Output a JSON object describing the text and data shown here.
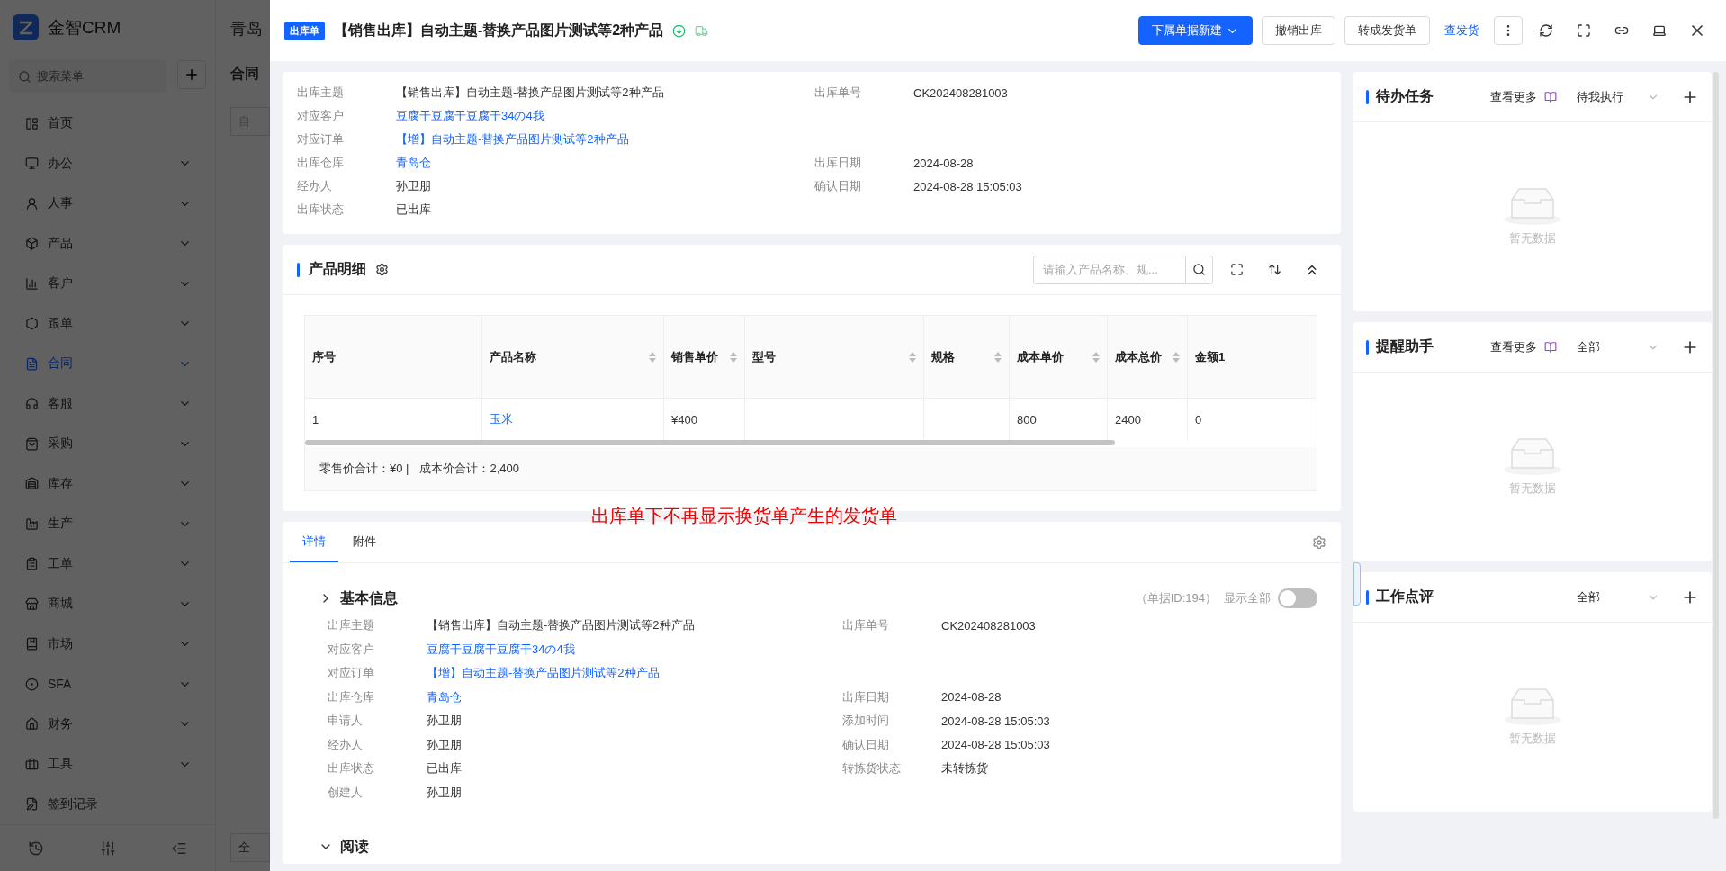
{
  "app": {
    "logo_text": "金智CRM",
    "search_placeholder": "搜索菜单",
    "bg_title": "青岛",
    "bg_heading": "合同",
    "bg_filter": "自",
    "bg_footer": "全",
    "menu": [
      {
        "label": "首页",
        "expandable": false,
        "selected": false
      },
      {
        "label": "办公",
        "expandable": true,
        "selected": false
      },
      {
        "label": "人事",
        "expandable": true,
        "selected": false
      },
      {
        "label": "产品",
        "expandable": true,
        "selected": false
      },
      {
        "label": "客户",
        "expandable": true,
        "selected": false
      },
      {
        "label": "跟单",
        "expandable": true,
        "selected": false
      },
      {
        "label": "合同",
        "expandable": true,
        "selected": true
      },
      {
        "label": "客服",
        "expandable": true,
        "selected": false
      },
      {
        "label": "采购",
        "expandable": true,
        "selected": false
      },
      {
        "label": "库存",
        "expandable": true,
        "selected": false
      },
      {
        "label": "生产",
        "expandable": true,
        "selected": false
      },
      {
        "label": "工单",
        "expandable": true,
        "selected": false
      },
      {
        "label": "商城",
        "expandable": true,
        "selected": false
      },
      {
        "label": "市场",
        "expandable": true,
        "selected": false
      },
      {
        "label": "SFA",
        "expandable": true,
        "selected": false
      },
      {
        "label": "财务",
        "expandable": true,
        "selected": false
      },
      {
        "label": "工具",
        "expandable": true,
        "selected": false
      },
      {
        "label": "签到记录",
        "expandable": false,
        "selected": false
      }
    ]
  },
  "drawer": {
    "badge": "出库单",
    "title": "【销售出库】自动主题-替换产品图片测试等2种产品",
    "actions": [
      {
        "kind": "primary",
        "label": "下属单据新建"
      },
      {
        "kind": "default",
        "label": "撤销出库"
      },
      {
        "kind": "default",
        "label": "转成发货单"
      },
      {
        "kind": "link",
        "label": "查发货"
      }
    ]
  },
  "summary": [
    {
      "left": {
        "label": "出库主题",
        "value": "【销售出库】自动主题-替换产品图片测试等2种产品",
        "link": false
      },
      "right": {
        "label": "出库单号",
        "value": "CK202408281003",
        "link": false
      }
    },
    {
      "left": {
        "label": "对应客户",
        "value": "豆腐干豆腐干豆腐干34の4我",
        "link": true
      }
    },
    {
      "left": {
        "label": "对应订单",
        "value": "【增】自动主题-替换产品图片测试等2种产品",
        "link": true
      }
    },
    {
      "left": {
        "label": "出库仓库",
        "value": "青岛仓",
        "link": true
      },
      "right": {
        "label": "出库日期",
        "value": "2024-08-28",
        "link": false
      }
    },
    {
      "left": {
        "label": "经办人",
        "value": "孙卫朋",
        "link": false
      },
      "right": {
        "label": "确认日期",
        "value": "2024-08-28 15:05:03",
        "link": false
      }
    },
    {
      "left": {
        "label": "出库状态",
        "value": "已出库",
        "link": false
      }
    }
  ],
  "products": {
    "title": "产品明细",
    "search_placeholder": "请输入产品名称、规...",
    "columns": [
      {
        "label": "序号",
        "sortable": false
      },
      {
        "label": "产品名称",
        "sortable": true
      },
      {
        "label": "销售单价",
        "sortable": true
      },
      {
        "label": "型号",
        "sortable": true
      },
      {
        "label": "规格",
        "sortable": true
      },
      {
        "label": "成本单价",
        "sortable": true
      },
      {
        "label": "成本总价",
        "sortable": true
      },
      {
        "label": "金额1",
        "sortable": false
      }
    ],
    "rows": [
      [
        {
          "text": "1",
          "link": false
        },
        {
          "text": "玉米",
          "link": true
        },
        {
          "text": "¥400",
          "link": false
        },
        {
          "text": ""
        },
        {
          "text": ""
        },
        {
          "text": "800",
          "link": false
        },
        {
          "text": "2400",
          "link": false
        },
        {
          "text": "0",
          "link": false
        }
      ]
    ],
    "totals": [
      "零售价合计：¥0 |",
      "成本价合计：2,400"
    ]
  },
  "annotation": "出库单下不再显示换货单产生的发货单",
  "detail": {
    "tabs": [
      {
        "label": "详情",
        "selected": true
      },
      {
        "label": "附件",
        "selected": false
      }
    ],
    "sections": [
      {
        "title": "基本信息",
        "expanded": true,
        "record_id": "（单据ID:194）",
        "show_all_label": "显示全部",
        "show_all_on": false,
        "rows": [
          {
            "left": {
              "label": "出库主题",
              "value": "【销售出库】自动主题-替换产品图片测试等2种产品",
              "link": false
            },
            "right": {
              "label": "出库单号",
              "value": "CK202408281003",
              "link": false
            }
          },
          {
            "left": {
              "label": "对应客户",
              "value": "豆腐干豆腐干豆腐干34の4我",
              "link": true
            }
          },
          {
            "left": {
              "label": "对应订单",
              "value": "【增】自动主题-替换产品图片测试等2种产品",
              "link": true
            }
          },
          {
            "left": {
              "label": "出库仓库",
              "value": "青岛仓",
              "link": true
            },
            "right": {
              "label": "出库日期",
              "value": "2024-08-28",
              "link": false
            }
          },
          {
            "left": {
              "label": "申请人",
              "value": "孙卫朋",
              "link": false
            },
            "right": {
              "label": "添加时间",
              "value": "2024-08-28 15:05:03",
              "link": false
            }
          },
          {
            "left": {
              "label": "经办人",
              "value": "孙卫朋",
              "link": false
            },
            "right": {
              "label": "确认日期",
              "value": "2024-08-28 15:05:03",
              "link": false
            }
          },
          {
            "left": {
              "label": "出库状态",
              "value": "已出库",
              "link": false
            },
            "right": {
              "label": "转拣货状态",
              "value": "未转拣货",
              "link": false
            }
          },
          {
            "left": {
              "label": "创建人",
              "value": "孙卫朋",
              "link": false
            }
          }
        ]
      },
      {
        "title": "阅读",
        "expanded": false
      }
    ]
  },
  "panels": [
    {
      "title": "待办任务",
      "more": "查看更多",
      "filter": "待我执行",
      "empty": "暂无数据"
    },
    {
      "title": "提醒助手",
      "more": "查看更多",
      "filter": "全部",
      "empty": "暂无数据"
    },
    {
      "title": "工作点评",
      "filter": "全部",
      "empty": "暂无数据"
    }
  ]
}
